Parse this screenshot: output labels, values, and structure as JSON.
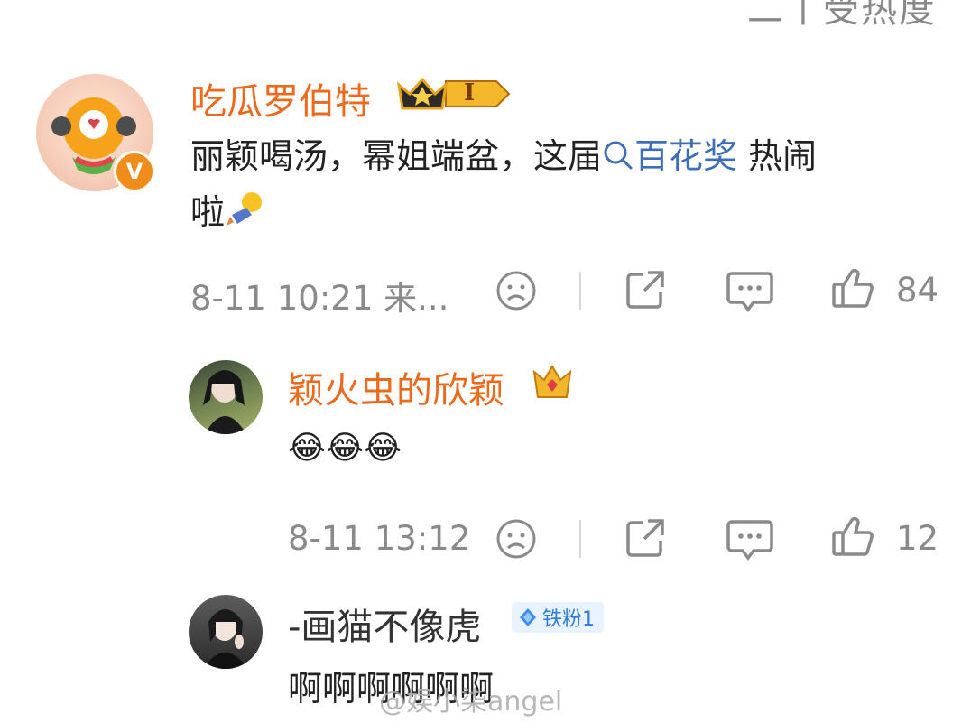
{
  "top_partial_text": "二丨受热度",
  "comments": [
    {
      "username": "吃瓜罗伯特",
      "level_badge": "I",
      "verified_badge": "V",
      "text_before_topic": "丽颖喝汤，幂姐端盆，这届",
      "topic": "百花奖",
      "text_after_topic": " 热闹",
      "text_line2": "啦",
      "time": "8-11 10:21 来...",
      "like_count": "84"
    },
    {
      "username": "颖火虫的欣颖",
      "text": "😂😂😂",
      "time": "8-11 13:12",
      "like_count": "12"
    },
    {
      "username": "-画猫不像虎",
      "fan_badge": "铁粉1",
      "text": "啊啊啊啊啊啊"
    }
  ],
  "watermark": "@娱小柒angel",
  "colors": {
    "username": "#ec6a1e",
    "topic": "#3d6fb8",
    "meta": "#8a8a8a"
  },
  "icons": [
    "search-icon",
    "frown-icon",
    "share-icon",
    "comment-icon",
    "thumbs-up-icon",
    "crown-icon",
    "diamond-icon"
  ]
}
